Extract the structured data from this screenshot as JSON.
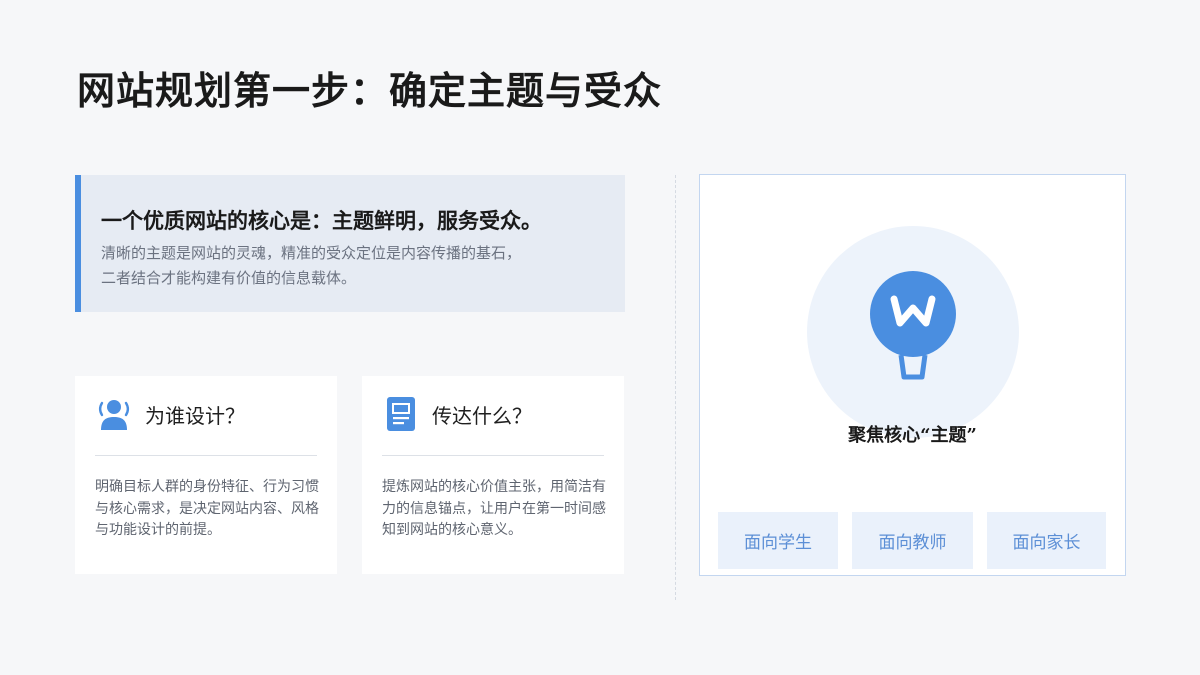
{
  "title": "网站规划第一步：确定主题与受众",
  "quote": {
    "headline": "一个优质网站的核心是：主题鲜明，服务受众。",
    "line1": "清晰的主题是网站的灵魂，精准的受众定位是内容传播的基石，",
    "line2": "二者结合才能构建有价值的信息载体。"
  },
  "cards": [
    {
      "icon": "user-icon",
      "title": "为谁设计？",
      "body": "明确目标人群的身份特征、行为习惯与核心需求，是决定网站内容、风格与功能设计的前提。"
    },
    {
      "icon": "document-icon",
      "title": "传达什么？",
      "body": "提炼网站的核心价值主张，用简洁有力的信息锚点，让用户在第一时间感知到网站的核心意义。"
    }
  ],
  "panel": {
    "icon": "balloon-icon",
    "label": "聚焦核心“主题”",
    "chips": [
      "面向学生",
      "面向教师",
      "面向家长"
    ]
  },
  "colors": {
    "accent": "#4a8ee0",
    "background": "#f6f7f9",
    "quote_bg": "#e6ebf3",
    "chip_bg": "#eaf1fb",
    "chip_text": "#5c8fd6"
  }
}
